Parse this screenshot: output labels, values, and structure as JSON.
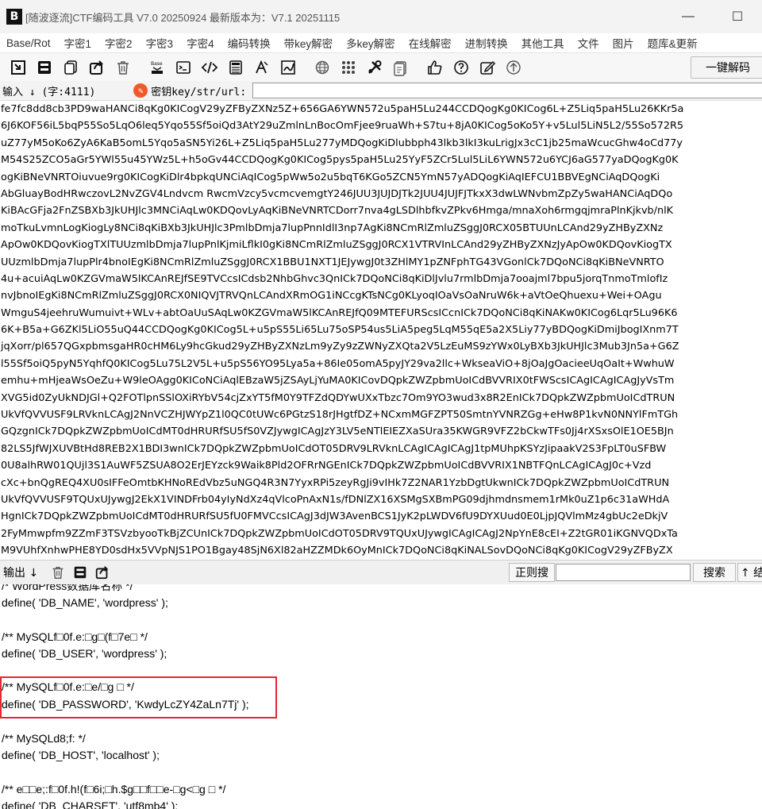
{
  "titlebar": {
    "logo": "B",
    "title": "[随波逐流]CTF编码工具 V7.0 20250924    最新版本为：V7.1  20251115",
    "minimize": "—",
    "maximize": "☐"
  },
  "menu": [
    "Base/Rot",
    "字密1",
    "字密2",
    "字密3",
    "字密4",
    "编码转换",
    "带key解密",
    "多key解密",
    "在线解密",
    "进制转换",
    "其他工具",
    "文件",
    "图片",
    "题库&更新"
  ],
  "toolbar": {
    "icons": [
      "import-icon",
      "save-icon",
      "copy-icon",
      "share-icon",
      "trash-icon",
      "base-convert-icon",
      "console-icon",
      "code-icon",
      "calculator-icon",
      "font-icon",
      "sign-icon",
      "globe-icon",
      "grid-icon",
      "tools-icon",
      "notes-icon",
      "thumbs-up-icon",
      "help-icon",
      "edit-icon",
      "up-arrow-icon"
    ],
    "decode_label": "一键解码"
  },
  "input": {
    "label": "输入 ↓ (字:4111)",
    "key_label": "密钥key/str/url:",
    "key_value": ""
  },
  "encoded_lines": [
    "fe7fc8dd8cb3PD9waHANCi8qKg0KICogV29yZFByZXNz5Z+656GA6YWN572u5paH5Lu244CCDQogKg0KICog6L+Z5Liq5paH5Lu26KKr5a",
    "6J6KOF56iL5bqP55So5LqO6leq5Yqo55Sf5oiQd3AtY29uZmlnLnBocOmFjee9ruaWh+S7tu+8jA0KICog5oKo5Y+v5Lul5LiN5L2/55So572R5",
    "uZ77yM5oKo6ZyA6KaB5omL5Yqo5aSN5Yi26L+Z5Liq5paH5Lu277yMDQogKiDlubbph43lkb3lkI3kuLrigJx3cC1jb25maWcucGhw4oCd77y",
    "M54S25ZCO5aGr5YWl55u45YWz5L+h5oGv44CCDQogKg0KICog5pys5paH5Lu25YyF5ZCr5Lul5LiL6YWN572u6YCJ6aG577yaDQogKg0K",
    "ogKiBNeVNRTOiuvue9rg0KICogKiDlr4bpkqUNCiAqICog5pWw5o2u5bqT6KGo5ZCN5YmN57yADQogKiAqIEFCU1BBVEgNCiAqDQogKi",
    "AbGluayBodHRwczovL2NvZGV4Lndvcm RwcmVzcy5vcmcvemgtY246JUU3JUJDJTk2JUU4JUJFJTkxX3dwLWNvbmZpZy5waHANCiAqDQo",
    "KiBAcGFja2FnZSBXb3JkUHJlc3MNCiAqLw0KDQovLyAqKiBNeVNRTCDorr7nva4gLSDlhbfkvZPkv6Hmga/mnaXoh6rmgqjmraPlnKjkvb/nlK",
    "moTkuLvmnLogKiogLy8NCi8qKiBXb3JkUHJlc3PmlbDmja7lupPnnIdlI3np7AgKi8NCmRlZmluZSggJ0RCX05BTUUnLCAnd29yZHByZXNz",
    "ApOw0KDQovKiogTXlTUUzmlbDmja7lupPnlKjmiLflkI0gKi8NCmRlZmluZSggJ0RCX1VTRVInLCAnd29yZHByZXNzJyApOw0KDQovKiogTX",
    "UUzmlbDmja7lupPlr4bnoIEgKi8NCmRlZmluZSggJ0RCX1BBU1NXT1JEJywgJ0t3ZHlMY1pZNFphTG43VGonlCk7DQoNCi8qKiBNeVNRTO",
    "4u+acuiAqLw0KZGVmaW5lKCAnREJfSE9TVCcsICdsb2NhbGhvc3QnICk7DQoNCi8qKiDlJvlu7rmlbDmja7ooajml7bpu5jorqTnmoTmlofIz",
    "nvJbnoIEgKi8NCmRlZmluZSggJ0RCX0NIQVJTRVQnLCAndXRmOG1iNCcgKTsNCg0KLyoqIOaVsOaNruW6k+aVtOeQhuexu+Wei+OAgu",
    "WmguS4jeehruWumuivt+WLv+abtOaUuSAqLw0KZGVmaW5lKCAnREJfQ09MTEFURScsICcnICk7DQoNCi8qKiNAKw0KICog6Lqr5Lu96K6",
    "6K+B5a+G6ZKl5LiO55uQ44CCDQogKg0KICog5L+u5pS55Li65Lu75oSP54us5LiA5peg5LqM55qE5a2X5Liy77yBDQogKiDmiJbogIXnm7T",
    "jqXorr/pl657QGxpbmsgaHR0cHM6Ly9hcGkud29yZHByZXNzLm9yZy9zZWNyZXQta2V5LzEuMS9zYWx0LyBXb3JkUHJlc3Mub3Jn5a+G6Z",
    "l55Sf5oiQ5pyN5YqhfQ0KICog5Lu75L2V5L+u5pS56YO95Lya5a+86Ie05omA5pyJY29va2llc+WkseaViO+8jOaJgOacieeUqOaIt+WwhuW",
    "emhu+mHjeaWsOeZu+W9leOAgg0KICoNCiAqlEBzaW5jZSAyLjYuMA0KICovDQpkZWZpbmUoICdBVVRIX0tFWScsICAgICAgICAgJyVsTm",
    "XVG5id0ZyUkNDJGl+Q2FOTlpnSSlOXiRYbV54cjZxYT5fM0Y9TFZdQDYwUXxTbzc7Om9YO3wud3x8R2EnICk7DQpkZWZpbmUoICdTRUN",
    "UkVfQVVUSF9LRVknLCAgJ2NnVCZHJWYpZ1l0QC0tUWc6PGtzS18rJHgtfDZ+NCxmMGFZPT50SmtnYVNRZGg+eHw8P1kvN0NNYlFmTGh",
    "GQzgnICk7DQpkZWZpbmUoICdMT0dHRURfSU5fS0VZJywgICAgJzY3LV5eNTlEIEZXaSUra35KWGR9VFZ2bCkwTFs0Jj4rXSxsOlE1OE5BJn",
    "82LS5JfWJXUVBtHd8REB2X1BDI3wnICk7DQpkZWZpbmUoICdOT05DRV9LRVknLCAgICAgICAgJ1tpMUhpKSYzJipaakV2S3FpLT0uSFBW",
    "0U8alhRW01QUjl3S1AuWF5ZSUA8O2ErJEYzck9Waik8Pld2OFRrNGEnICk7DQpkZWZpbmUoICdBVVRIX1NBTFQnLCAgICAgJ0c+Vzd",
    "cXc+bnQgREQ4XU0sIFFeOmtbKHNoREdVbz5uNGQ4R3N7YyxRPi5zeyRgJi9vIHk7Z2NAR1YzbDgtUkwnICk7DQpkZWZpbmUoICdTRUN",
    "UkVfQVVUSF9TQUxUJywgJ2EkX1VINDFrb04yIyNdXz4qVlcoPnAxN1s/fDNlZX16XSMgSXBmPG09djhmdnsmem1rMk0uZ1p6c31aWHdA",
    "HgnICk7DQpkZWZpbmUoICdMT0dHRURfSU5fU0FMVCcsICAgJ3dJW3AvenBCS1JyK2pLWDV6fU9DYXUud0E0LjpJQVlmMz4gbUc2eDkjV",
    "2FyMmwpfm9ZZmF3TSVzbyooTkBjZCUnICk7DQpkZWZpbmUoICdOT05DRV9TQUxUJywgICAgICAgJ2NpYnE8cEI+Z2tGR01iKGNVQDxTa",
    "M9VUhfXnhwPHE8YD0sdHx5VVpNJS1PO1Bgay48SjN6Xl82aHZZMDk6OyMnICk7DQoNCi8qKiNALSovDQoNCi8qKg0KICogV29yZFByZX"
  ],
  "output": {
    "label": "输出 ↓",
    "regex_label": "正则搜",
    "search_value": "",
    "search_label": "搜索",
    "top_label": "↑ 结"
  },
  "output_lines": [
    "/* WordPress数据库名称 */",
    "define( 'DB_NAME', 'wordpress' );",
    "",
    "/** MySQLf□0f.e:□g□(f□7e□ */",
    "define( 'DB_USER', 'wordpress' );",
    "",
    "/** MySQLf□0f.e:□e/□g □ */",
    "define( 'DB_PASSWORD', 'KwdyLcZY4ZaLn7Tj' );",
    "",
    "/** MySQLd8;f: */",
    "define( 'DB_HOST', 'localhost' );",
    "",
    "/** e□□e;:f□0f.h!(f□6i;□h.$g□□f□□e-□g<□g □ */",
    "define( 'DB_CHARSET', 'utf8mb4' );"
  ],
  "colors": {
    "highlight": "#e8262d",
    "key_icon": "#f05a28"
  }
}
